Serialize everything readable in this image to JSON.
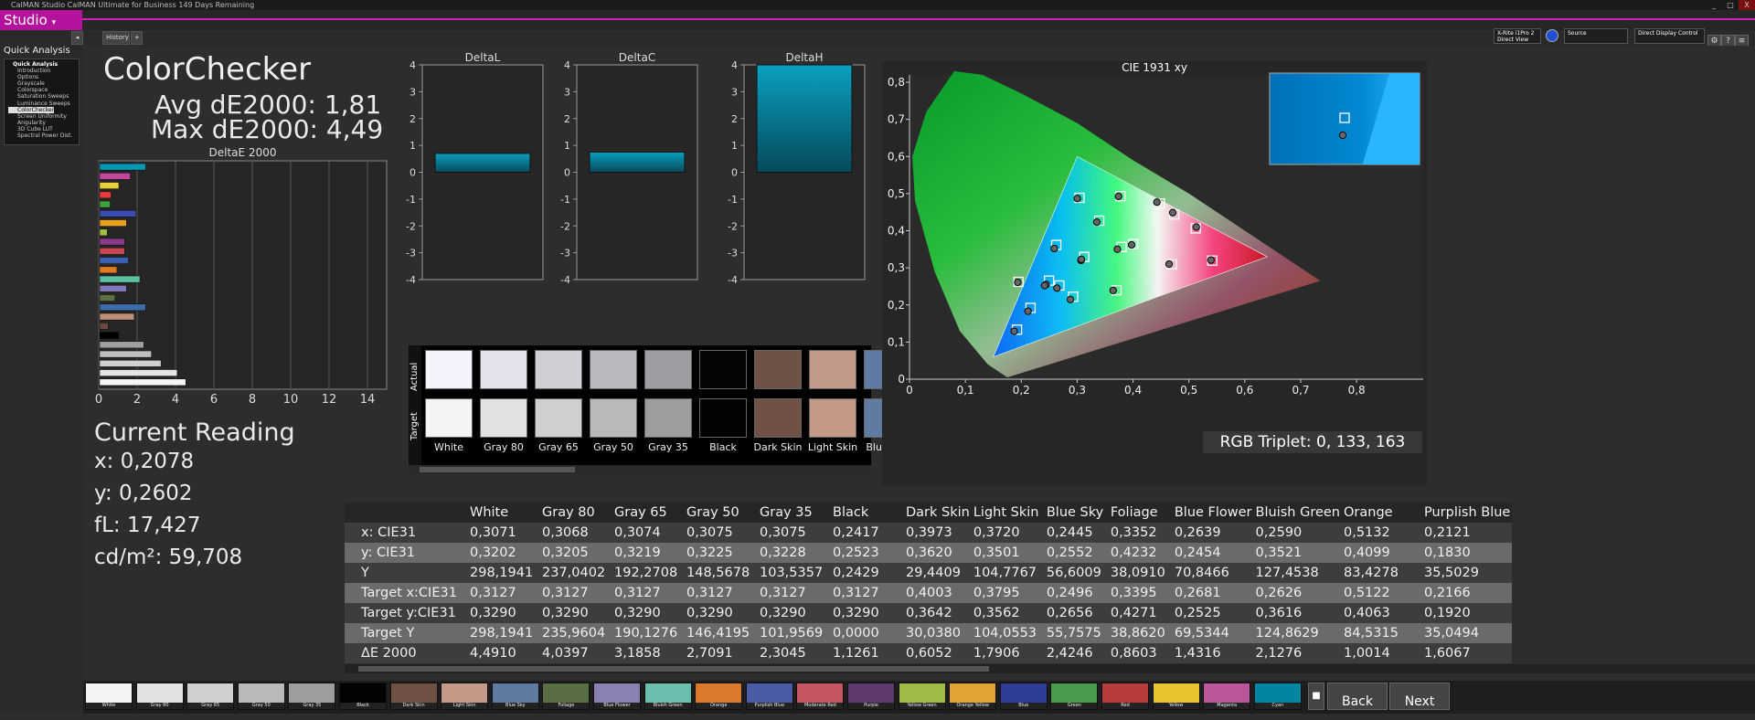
{
  "window": {
    "title": "CalMAN Studio CalMAN Ultimate for Business 149 Days Remaining",
    "controls": [
      "_",
      "□",
      "X"
    ]
  },
  "studio": {
    "label": "Studio"
  },
  "tabs": [
    {
      "label": "History 1"
    }
  ],
  "toolbar_right": {
    "meter": "X-Rite i1Pro 2 Direct View",
    "source": "Source",
    "display": "Direct Display Control"
  },
  "sidebar": {
    "title": "Quick Analysis",
    "items": [
      {
        "label": "Quick Analysis",
        "kind": "head"
      },
      {
        "label": "Introduction"
      },
      {
        "label": "Options"
      },
      {
        "label": "Grayscale"
      },
      {
        "label": "Colorspace"
      },
      {
        "label": "Saturation Sweeps"
      },
      {
        "label": "Luminance Sweeps"
      },
      {
        "label": "ColorChecker",
        "kind": "active"
      },
      {
        "label": "Screen Uniformity"
      },
      {
        "label": "Angularity"
      },
      {
        "label": "3D Cube LUT"
      },
      {
        "label": "Spectral Power Dist."
      }
    ]
  },
  "summary": {
    "title": "ColorChecker",
    "avg": "Avg dE2000: 1,81",
    "max": "Max dE2000: 4,49"
  },
  "current_reading": {
    "title": "Current Reading",
    "x": "x: 0,2078",
    "y": "y: 0,2602",
    "fl": "fL: 17,427",
    "cdm2": "cd/m²: 59,708"
  },
  "rgb_triplet": "RGB Triplet: 0, 133, 163",
  "chart_data": [
    {
      "type": "bar",
      "orientation": "horizontal",
      "title": "DeltaE 2000",
      "xlim": [
        0,
        15
      ],
      "xticks": [
        "0",
        "2",
        "4",
        "6",
        "8",
        "10",
        "12",
        "14"
      ],
      "values": [
        2.4,
        1.6,
        1.0,
        0.6,
        0.55,
        1.9,
        1.4,
        0.4,
        1.3,
        1.3,
        1.5,
        0.9,
        2.1,
        1.4,
        0.8,
        2.4,
        1.8,
        0.45,
        1.0,
        2.3,
        2.7,
        3.2,
        4.04,
        4.49
      ],
      "colors": [
        "#0099b3",
        "#c2479c",
        "#e8d23a",
        "#e83a3a",
        "#3da33d",
        "#3d4cb0",
        "#e8a020",
        "#a0c040",
        "#8a3a8a",
        "#c8474f",
        "#3d60b0",
        "#e07a20",
        "#5cc0a0",
        "#8078b8",
        "#5a7040",
        "#3d6ca8",
        "#c0907a",
        "#6a4a3c",
        "#000000",
        "#a0a0a0",
        "#bfbfbf",
        "#d0d0d0",
        "#e6e6e6",
        "#f5f5f5"
      ]
    },
    {
      "type": "bar",
      "title": "DeltaL",
      "ylim": [
        -4,
        4
      ],
      "yticks": [
        "4",
        "3",
        "2",
        "1",
        "0",
        "-1",
        "-2",
        "-3",
        "-4"
      ],
      "values": [
        0.7
      ]
    },
    {
      "type": "bar",
      "title": "DeltaC",
      "ylim": [
        -4,
        4
      ],
      "yticks": [
        "4",
        "3",
        "2",
        "1",
        "0",
        "-1",
        "-2",
        "-3",
        "-4"
      ],
      "values": [
        0.75
      ]
    },
    {
      "type": "bar",
      "title": "DeltaH",
      "ylim": [
        -4,
        4
      ],
      "yticks": [
        "4",
        "3",
        "2",
        "1",
        "0",
        "-1",
        "-2",
        "-3",
        "-4"
      ],
      "values": [
        4.0
      ]
    },
    {
      "type": "scatter",
      "title": "CIE 1931 xy",
      "xlim": [
        0,
        0.8
      ],
      "ylim": [
        0,
        0.85
      ],
      "xticks": [
        "0",
        "0,1",
        "0,2",
        "0,3",
        "0,4",
        "0,5",
        "0,6",
        "0,7",
        "0,8"
      ],
      "yticks": [
        "0",
        "0,1",
        "0,2",
        "0,3",
        "0,4",
        "0,5",
        "0,6",
        "0,7",
        "0,8"
      ],
      "gamut": [
        [
          0.64,
          0.33
        ],
        [
          0.3,
          0.6
        ],
        [
          0.15,
          0.06
        ]
      ],
      "targets": [
        [
          0.3127,
          0.329
        ],
        [
          0.4003,
          0.3642
        ],
        [
          0.3795,
          0.3562
        ],
        [
          0.2496,
          0.2656
        ],
        [
          0.3395,
          0.4271
        ],
        [
          0.2681,
          0.2525
        ],
        [
          0.2626,
          0.3616
        ],
        [
          0.5122,
          0.4063
        ],
        [
          0.2166,
          0.192
        ],
        [
          0.4694,
          0.3092
        ],
        [
          0.2928,
          0.2221
        ],
        [
          0.3775,
          0.4931
        ],
        [
          0.4737,
          0.4438
        ],
        [
          0.1924,
          0.1334
        ],
        [
          0.3042,
          0.4886
        ],
        [
          0.5418,
          0.3194
        ],
        [
          0.4481,
          0.4733
        ],
        [
          0.3705,
          0.2396
        ],
        [
          0.1951,
          0.2622
        ],
        [
          0.3127,
          0.329
        ],
        [
          0.3127,
          0.329
        ],
        [
          0.3127,
          0.329
        ],
        [
          0.3127,
          0.329
        ],
        [
          0.3127,
          0.329
        ]
      ],
      "measured": [
        [
          0.3071,
          0.3202
        ],
        [
          0.3973,
          0.362
        ],
        [
          0.372,
          0.3501
        ],
        [
          0.2445,
          0.2552
        ],
        [
          0.3352,
          0.4232
        ],
        [
          0.2639,
          0.2454
        ],
        [
          0.259,
          0.3521
        ],
        [
          0.5132,
          0.4099
        ],
        [
          0.2121,
          0.183
        ],
        [
          0.4645,
          0.3101
        ],
        [
          0.2879,
          0.2147
        ],
        [
          0.374,
          0.4927
        ],
        [
          0.471,
          0.4488
        ],
        [
          0.1873,
          0.1291
        ],
        [
          0.3003,
          0.4867
        ],
        [
          0.5394,
          0.321
        ],
        [
          0.4427,
          0.477
        ],
        [
          0.3644,
          0.239
        ],
        [
          0.1937,
          0.2609
        ],
        [
          0.3068,
          0.3205
        ],
        [
          0.3074,
          0.3219
        ],
        [
          0.3075,
          0.3225
        ],
        [
          0.3075,
          0.3228
        ],
        [
          0.2417,
          0.2523
        ]
      ]
    }
  ],
  "swatches": {
    "row_labels": [
      "Actual",
      "Target"
    ],
    "items": [
      {
        "label": "White",
        "actual": "#f2f3fb",
        "target": "#f4f4f4"
      },
      {
        "label": "Gray 80",
        "actual": "#e2e3ea",
        "target": "#e2e2e2"
      },
      {
        "label": "Gray 65",
        "actual": "#cfd0d6",
        "target": "#cfcfcf"
      },
      {
        "label": "Gray 50",
        "actual": "#b9babf",
        "target": "#bababa"
      },
      {
        "label": "Gray 35",
        "actual": "#9d9ea2",
        "target": "#9d9d9d"
      },
      {
        "label": "Black",
        "actual": "#050508",
        "target": "#020202"
      },
      {
        "label": "Dark Skin",
        "actual": "#6e5246",
        "target": "#6f5245"
      },
      {
        "label": "Light Skin",
        "actual": "#c3998a",
        "target": "#c49987"
      },
      {
        "label": "Blue Sky",
        "actual": "#5e7aa3",
        "target": "#5f7ba2"
      }
    ]
  },
  "table": {
    "columns": [
      "White",
      "Gray 80",
      "Gray 65",
      "Gray 50",
      "Gray 35",
      "Black",
      "Dark Skin",
      "Light Skin",
      "Blue Sky",
      "Foliage",
      "Blue Flower",
      "Bluish Green",
      "Orange",
      "Purplish Blue"
    ],
    "rows": [
      {
        "label": "x: CIE31",
        "values": [
          "0,3071",
          "0,3068",
          "0,3074",
          "0,3075",
          "0,3075",
          "0,2417",
          "0,3973",
          "0,3720",
          "0,2445",
          "0,3352",
          "0,2639",
          "0,2590",
          "0,5132",
          "0,2121"
        ]
      },
      {
        "label": "y: CIE31",
        "values": [
          "0,3202",
          "0,3205",
          "0,3219",
          "0,3225",
          "0,3228",
          "0,2523",
          "0,3620",
          "0,3501",
          "0,2552",
          "0,4232",
          "0,2454",
          "0,3521",
          "0,4099",
          "0,1830"
        ]
      },
      {
        "label": "Y",
        "values": [
          "298,1941",
          "237,0402",
          "192,2708",
          "148,5678",
          "103,5357",
          "0,2429",
          "29,4409",
          "104,7767",
          "56,6009",
          "38,0910",
          "70,8466",
          "127,4538",
          "83,4278",
          "35,5029"
        ]
      },
      {
        "label": "Target x:CIE31",
        "values": [
          "0,3127",
          "0,3127",
          "0,3127",
          "0,3127",
          "0,3127",
          "0,3127",
          "0,4003",
          "0,3795",
          "0,2496",
          "0,3395",
          "0,2681",
          "0,2626",
          "0,5122",
          "0,2166"
        ]
      },
      {
        "label": "Target y:CIE31",
        "values": [
          "0,3290",
          "0,3290",
          "0,3290",
          "0,3290",
          "0,3290",
          "0,3290",
          "0,3642",
          "0,3562",
          "0,2656",
          "0,4271",
          "0,2525",
          "0,3616",
          "0,4063",
          "0,1920"
        ]
      },
      {
        "label": "Target Y",
        "values": [
          "298,1941",
          "235,9604",
          "190,1276",
          "146,4195",
          "101,9569",
          "0,0000",
          "30,0380",
          "104,0553",
          "55,7575",
          "38,8620",
          "69,5344",
          "124,8629",
          "84,5315",
          "35,0494"
        ]
      },
      {
        "label": "ΔE 2000",
        "values": [
          "4,4910",
          "4,0397",
          "3,1858",
          "2,7091",
          "2,3045",
          "1,1261",
          "0,6052",
          "1,7906",
          "2,4246",
          "0,8603",
          "1,4316",
          "2,1276",
          "1,0014",
          "1,6067"
        ]
      }
    ]
  },
  "bottom_swatches": [
    {
      "label": "White",
      "color": "#f4f4f4"
    },
    {
      "label": "Gray 80",
      "color": "#e2e2e2"
    },
    {
      "label": "Gray 65",
      "color": "#cfcfcf"
    },
    {
      "label": "Gray 50",
      "color": "#bababa"
    },
    {
      "label": "Gray 35",
      "color": "#9d9d9d"
    },
    {
      "label": "Black",
      "color": "#020202"
    },
    {
      "label": "Dark Skin",
      "color": "#6f5245"
    },
    {
      "label": "Light Skin",
      "color": "#c49987"
    },
    {
      "label": "Blue Sky",
      "color": "#5f7ba2"
    },
    {
      "label": "Foliage",
      "color": "#5a6e43"
    },
    {
      "label": "Blue Flower",
      "color": "#8882b3"
    },
    {
      "label": "Bluish Green",
      "color": "#6bbfae"
    },
    {
      "label": "Orange",
      "color": "#dc7a2c"
    },
    {
      "label": "Purplish Blue",
      "color": "#4a5ba8"
    },
    {
      "label": "Moderate Red",
      "color": "#c65462"
    },
    {
      "label": "Purple",
      "color": "#5d3a6b"
    },
    {
      "label": "Yellow Green",
      "color": "#a0bc47"
    },
    {
      "label": "Orange Yellow",
      "color": "#e2a334"
    },
    {
      "label": "Blue",
      "color": "#2f3d94"
    },
    {
      "label": "Green",
      "color": "#4c9a4b"
    },
    {
      "label": "Red",
      "color": "#b83c3c"
    },
    {
      "label": "Yellow",
      "color": "#e7c531"
    },
    {
      "label": "Magenta",
      "color": "#bb569a"
    },
    {
      "label": "Cyan",
      "color": "#0085a3"
    }
  ],
  "nav": {
    "back": "Back",
    "next": "Next"
  }
}
